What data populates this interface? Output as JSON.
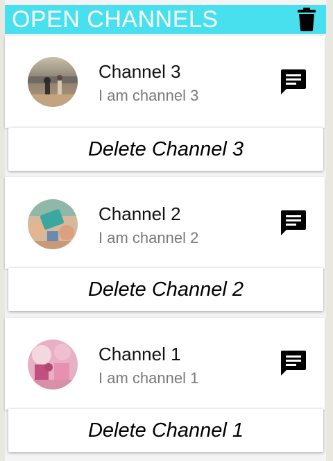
{
  "header": {
    "title": "OPEN CHANNELS",
    "icon": "trash-icon",
    "color": "#48e0ee"
  },
  "channels": [
    {
      "title": "Channel 3",
      "subtitle": "I am channel 3",
      "delete_label": "Delete Channel 3",
      "avatar": "beach-photo",
      "action_icon": "chat-icon"
    },
    {
      "title": "Channel 2",
      "subtitle": "I am channel 2",
      "delete_label": "Delete Channel 2",
      "avatar": "tablet-photo",
      "action_icon": "chat-icon"
    },
    {
      "title": "Channel 1",
      "subtitle": "I am channel 1",
      "delete_label": "Delete Channel 1",
      "avatar": "party-photo",
      "action_icon": "chat-icon"
    }
  ]
}
